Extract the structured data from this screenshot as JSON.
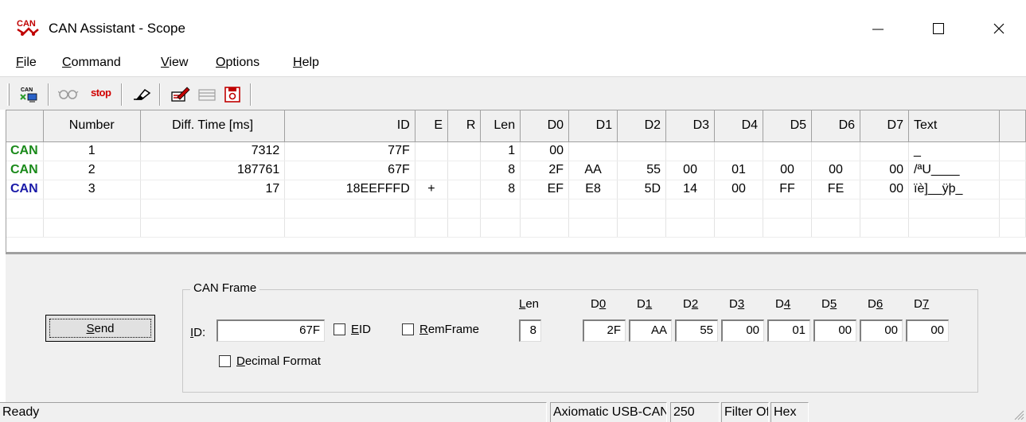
{
  "window": {
    "title": "CAN Assistant - Scope",
    "app_icon": "can-assistant-icon"
  },
  "menu": [
    {
      "u": "F",
      "rest": "ile"
    },
    {
      "u": "C",
      "rest": "ommand"
    },
    {
      "u": "V",
      "rest": "iew"
    },
    {
      "u": "O",
      "rest": "ptions"
    },
    {
      "u": "H",
      "rest": "elp"
    }
  ],
  "toolbar": {
    "stop_label": "stop"
  },
  "grid": {
    "columns": [
      "Number",
      "Diff. Time [ms]",
      "ID",
      "E",
      "R",
      "Len",
      "D0",
      "D1",
      "D2",
      "D3",
      "D4",
      "D5",
      "D6",
      "D7",
      "Text"
    ],
    "rows": [
      {
        "tag": "CAN",
        "tag_color": "#1a8a1a",
        "cells": [
          "1",
          "7312",
          "77F",
          "",
          "",
          "1",
          "00",
          "",
          "",
          "",
          "",
          "",
          "",
          "",
          "_"
        ]
      },
      {
        "tag": "CAN",
        "tag_color": "#1a8a1a",
        "cells": [
          "2",
          "187761",
          "67F",
          "",
          "",
          "8",
          "2F",
          "AA",
          "55",
          "00",
          "01",
          "00",
          "00",
          "00",
          "/ªU____"
        ]
      },
      {
        "tag": "CAN",
        "tag_color": "#1a1aa8",
        "cells": [
          "3",
          "17",
          "18EEFFFD",
          "+",
          "",
          "8",
          "EF",
          "E8",
          "5D",
          "14",
          "00",
          "FF",
          "FE",
          "00",
          "ïè]__ÿþ_"
        ]
      }
    ]
  },
  "frame": {
    "group_title": "CAN Frame",
    "send_u": "S",
    "send_rest": "end",
    "id_u": "I",
    "id_rest": "D:",
    "id_value": "67F",
    "eid_u": "E",
    "eid_rest": "ID",
    "remframe_u": "R",
    "remframe_rest": "emFrame",
    "decimal_u": "D",
    "decimal_rest": "ecimal Format",
    "len_u": "L",
    "len_rest": "en",
    "len_value": "8",
    "data": [
      {
        "label": "D",
        "digit": "0",
        "value": "2F"
      },
      {
        "label": "D",
        "digit": "1",
        "value": "AA"
      },
      {
        "label": "D",
        "digit": "2",
        "value": "55"
      },
      {
        "label": "D",
        "digit": "3",
        "value": "00"
      },
      {
        "label": "D",
        "digit": "4",
        "value": "01"
      },
      {
        "label": "D",
        "digit": "5",
        "value": "00"
      },
      {
        "label": "D",
        "digit": "6",
        "value": "00"
      },
      {
        "label": "D",
        "digit": "7",
        "value": "00"
      }
    ]
  },
  "status": {
    "message": "Ready",
    "device": "Axiomatic USB-CAN Converter",
    "bitrate": "250",
    "filter": "Filter Off",
    "format": "Hex"
  }
}
